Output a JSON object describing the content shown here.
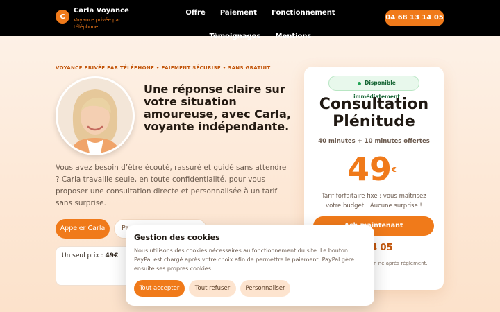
{
  "header": {
    "logo_letter": "C",
    "brand_name": "Carla Voyance",
    "brand_tagline": "Voyance privée par téléphone",
    "nav": [
      "Offre",
      "Paiement",
      "Fonctionnement",
      "Témoignages",
      "Mentions"
    ],
    "phone": "04 68 13 14 05"
  },
  "hero": {
    "eyebrow": "VOYANCE PRIVÉE PAR TÉLÉPHONE • PAIEMENT SÉCURISÉ • SANS GRATUIT",
    "headline": "Une réponse claire sur votre situation amoureuse, avec Carla, voyante indépendante.",
    "lead": "Vous avez besoin d’être écouté, rassuré et guidé sans attendre ? Carla travaille seule, en toute confidentialité, pour vous proposer une consultation directe et personnalisée à un tarif sans surprise.",
    "call_button": "Appeler Carla",
    "pay_button": "Pa",
    "price_label": "Un seul prix :",
    "price_value": "49€"
  },
  "offer": {
    "badge": "Disponible immédiatement",
    "title": "Consultation Plénitude",
    "subtitle": "40 minutes + 10 minutes offertes",
    "price": "49",
    "currency": "€",
    "note": "Tarif forfaitaire fixe : vous maîtrisez votre budget ! Aucune surprise !",
    "cta": "Ach          maintenant",
    "phone_partial": "3 14 05",
    "footer": "pérateur. Consultation ne après règlement."
  },
  "cookie": {
    "title": "Gestion des cookies",
    "text": "Nous utilisons des cookies nécessaires au fonctionnement du site. Le bouton PayPal est chargé après votre choix afin de permettre le paiement, PayPal gère ensuite ses propres cookies.",
    "accept": "Tout accepter",
    "refuse": "Tout refuser",
    "customize": "Personnaliser"
  },
  "colors": {
    "accent": "#f07a1a",
    "header_bg": "#000000",
    "success": "#22a455"
  }
}
